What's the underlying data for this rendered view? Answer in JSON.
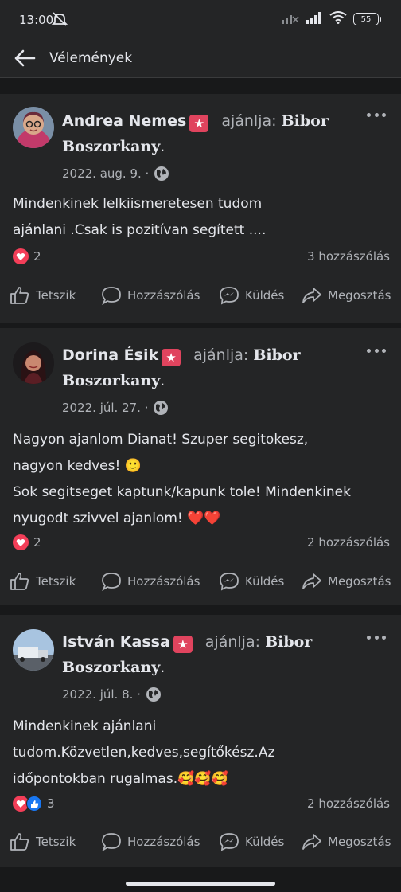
{
  "status_bar": {
    "time": "13:00",
    "battery": "55"
  },
  "header": {
    "title": "Vélemények"
  },
  "colors": {
    "background": "#18191a",
    "card": "#242526",
    "love": "#f33e58",
    "like": "#1877f2",
    "badge": "#e0445e"
  },
  "actions": {
    "like": "Tetszik",
    "comment": "Hozzászólás",
    "send": "Küldés",
    "share": "Megosztás"
  },
  "posts": [
    {
      "author": "Andrea Nemes",
      "recommends": "ajánlja:",
      "page": "Bibor Boszorkany",
      "page_end": ".",
      "date": "2022. aug. 9. ·",
      "text_lines": [
        "Mindenkinek lelkiismeretesen tudom",
        "ajánlani .Csak is pozitívan segített ...."
      ],
      "reactions": [
        "love"
      ],
      "reaction_count": "2",
      "comments": "3 hozzászólás"
    },
    {
      "author": "Dorina Ésik",
      "recommends": "ajánlja:",
      "page": "Bibor Boszorkany",
      "page_end": ".",
      "date": "2022. júl. 27. ·",
      "text_lines": [
        "Nagyon ajanlom Dianat! Szuper segitokesz,",
        "nagyon kedves! 🙂",
        "Sok segitseget kaptunk/kapunk tole! Mindenkinek",
        "nyugodt szivvel ajanlom! ❤️❤️"
      ],
      "reactions": [
        "love"
      ],
      "reaction_count": "2",
      "comments": "2 hozzászólás"
    },
    {
      "author": "István Kassa",
      "recommends": "ajánlja:",
      "page": "Bibor Boszorkany",
      "page_end": ".",
      "date": "2022. júl. 8. ·",
      "text_lines": [
        "Mindenkinek ajánlani",
        "tudom.Közvetlen,kedves,segítőkész.Az",
        "időpontokban rugalmas.🥰🥰🥰"
      ],
      "reactions": [
        "love",
        "like"
      ],
      "reaction_count": "3",
      "comments": "2 hozzászólás"
    }
  ]
}
